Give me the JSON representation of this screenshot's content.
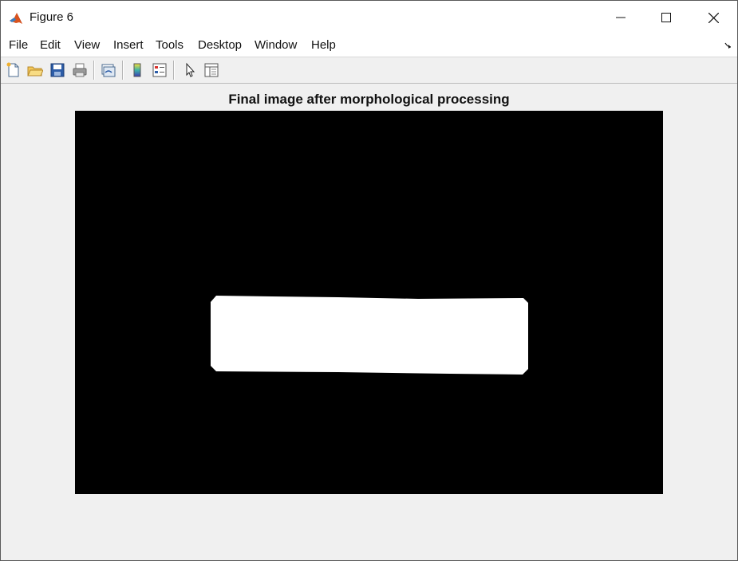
{
  "window": {
    "title": "Figure 6"
  },
  "menu": {
    "items": [
      {
        "label": "File"
      },
      {
        "label": "Edit"
      },
      {
        "label": "View"
      },
      {
        "label": "Insert"
      },
      {
        "label": "Tools"
      },
      {
        "label": "Desktop"
      },
      {
        "label": "Window"
      },
      {
        "label": "Help"
      }
    ]
  },
  "toolbar": {
    "buttons": [
      "new-figure-icon",
      "open-file-icon",
      "save-icon",
      "print-icon",
      "link-plot-icon",
      "insert-colorbar-icon",
      "insert-legend-icon",
      "edit-plot-icon",
      "property-inspector-icon"
    ]
  },
  "axes": {
    "title": "Final image after morphological processing"
  },
  "colors": {
    "background": "#000000",
    "foreground": "#ffffff",
    "figure": "#f0f0f0"
  }
}
